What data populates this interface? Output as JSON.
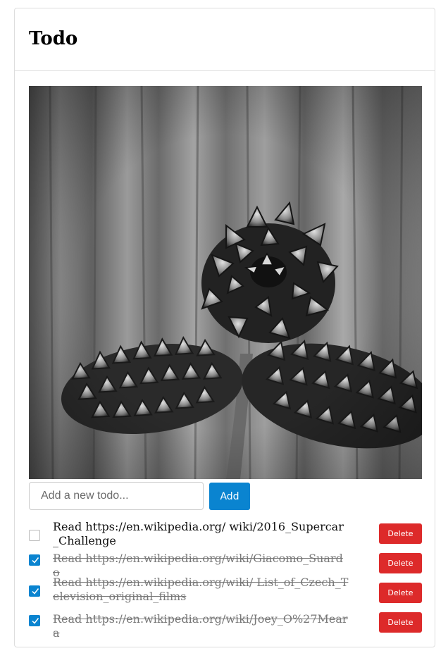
{
  "header": {
    "title": "Todo"
  },
  "hero": {
    "alt": "Black and white photo of pine cones on a wooden surface"
  },
  "new_todo": {
    "placeholder": "Add a new todo...",
    "value": "",
    "add_label": "Add"
  },
  "todos": [
    {
      "text": "Read https://en.wikipedia.org/ wiki/2016_Supercar_Challenge",
      "done": false,
      "delete_label": "Delete"
    },
    {
      "text": "Read https://en.wikipedia.org/wiki/Giacomo_Suardo",
      "done": true,
      "delete_label": "Delete"
    },
    {
      "text": "Read https://en.wikipedia.org/wiki/ List_of_Czech_Television_original_films",
      "done": true,
      "delete_label": "Delete"
    },
    {
      "text": "Read https://en.wikipedia.org/wiki/Joey_O%27Meara",
      "done": true,
      "delete_label": "Delete"
    }
  ],
  "colors": {
    "accent": "#0a84d0",
    "danger": "#dd2a2a",
    "border": "#dddddd"
  }
}
